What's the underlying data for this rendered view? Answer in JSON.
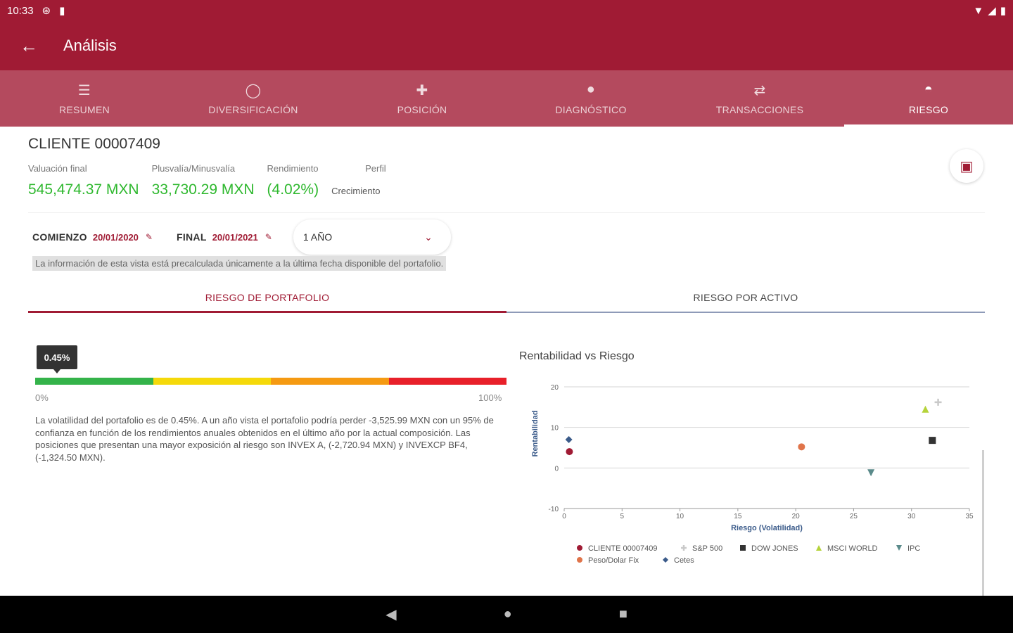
{
  "status": {
    "time": "10:33",
    "icons_left": [
      "at-icon",
      "sd-card-icon"
    ],
    "icons_right": [
      "wifi-icon",
      "signal-icon",
      "battery-icon"
    ]
  },
  "appbar": {
    "title": "Análisis"
  },
  "tabs": [
    {
      "label": "RESUMEN",
      "icon": "list-icon",
      "active": false
    },
    {
      "label": "DIVERSIFICACIÓN",
      "icon": "donut-icon",
      "active": false
    },
    {
      "label": "POSICIÓN",
      "icon": "grid-icon",
      "active": false
    },
    {
      "label": "DIAGNÓSTICO",
      "icon": "magnifier-icon",
      "active": false
    },
    {
      "label": "TRANSACCIONES",
      "icon": "swap-icon",
      "active": false
    },
    {
      "label": "RIESGO",
      "icon": "gauge-icon",
      "active": true
    }
  ],
  "client": {
    "title": "CLIENTE 00007409"
  },
  "metrics": {
    "valuation_label": "Valuación final",
    "valuation_value": "545,474.37 MXN",
    "gain_label": "Plusvalía/Minusvalía",
    "gain_value": "33,730.29 MXN",
    "return_label": "Rendimiento",
    "return_value": "(4.02%)",
    "profile_label": "Perfil",
    "profile_value": "Crecimiento"
  },
  "dates": {
    "start_label": "COMIENZO",
    "start_value": "20/01/2020",
    "end_label": "FINAL",
    "end_value": "20/01/2021",
    "period_value": "1 AÑO"
  },
  "notice": "La información de esta vista está precalculada únicamente a la última fecha disponible del portafolio.",
  "subtabs": {
    "portfolio": "RIESGO DE PORTAFOLIO",
    "asset": "RIESGO POR ACTIVO"
  },
  "gauge": {
    "value_label": "0.45%",
    "value_fraction": 0.0045,
    "min_label": "0%",
    "max_label": "100%",
    "colors": [
      "#34b34a",
      "#f5d90a",
      "#f59a12",
      "#e8202a"
    ]
  },
  "description": "La volatilidad del portafolio es de 0.45%. A un año vista el portafolio podría perder -3,525.99 MXN con un 95% de confianza en función de los rendimientos anuales obtenidos en el último año por la actual composición. Las posiciones que presentan una mayor exposición al riesgo son INVEX A, (-2,720.94 MXN) y INVEXCP BF4, (-1,324.50 MXN).",
  "chart_data": {
    "type": "scatter",
    "title": "Rentabilidad vs Riesgo",
    "xlabel": "Riesgo (Volatilidad)",
    "ylabel": "Rentabilidad",
    "xlim": [
      0,
      35
    ],
    "ylim": [
      -10,
      20
    ],
    "xticks": [
      0,
      5,
      10,
      15,
      20,
      25,
      30,
      35
    ],
    "yticks": [
      -10,
      0,
      10,
      20
    ],
    "grid": true,
    "legend_position": "bottom",
    "series": [
      {
        "name": "CLIENTE 00007409",
        "marker": "circle",
        "color": "#a01b34",
        "points": [
          [
            0.45,
            4.02
          ]
        ]
      },
      {
        "name": "S&P 500",
        "marker": "plus",
        "color": "#c9c9c9",
        "points": [
          [
            32.3,
            16.2
          ]
        ]
      },
      {
        "name": "DOW JONES",
        "marker": "square",
        "color": "#333333",
        "points": [
          [
            31.8,
            6.8
          ]
        ]
      },
      {
        "name": "MSCI WORLD",
        "marker": "triangle",
        "color": "#b5d33a",
        "points": [
          [
            31.2,
            14.5
          ]
        ]
      },
      {
        "name": "IPC",
        "marker": "triangle-down",
        "color": "#5a8a8a",
        "points": [
          [
            26.5,
            -1.2
          ]
        ]
      },
      {
        "name": "Peso/Dolar Fix",
        "marker": "circle",
        "color": "#e0744a",
        "points": [
          [
            20.5,
            5.2
          ]
        ]
      },
      {
        "name": "Cetes",
        "marker": "diamond",
        "color": "#3b5b8a",
        "points": [
          [
            0.4,
            7.0
          ]
        ]
      }
    ]
  },
  "nav": {
    "back": "◀",
    "home": "●",
    "recents": "■"
  }
}
